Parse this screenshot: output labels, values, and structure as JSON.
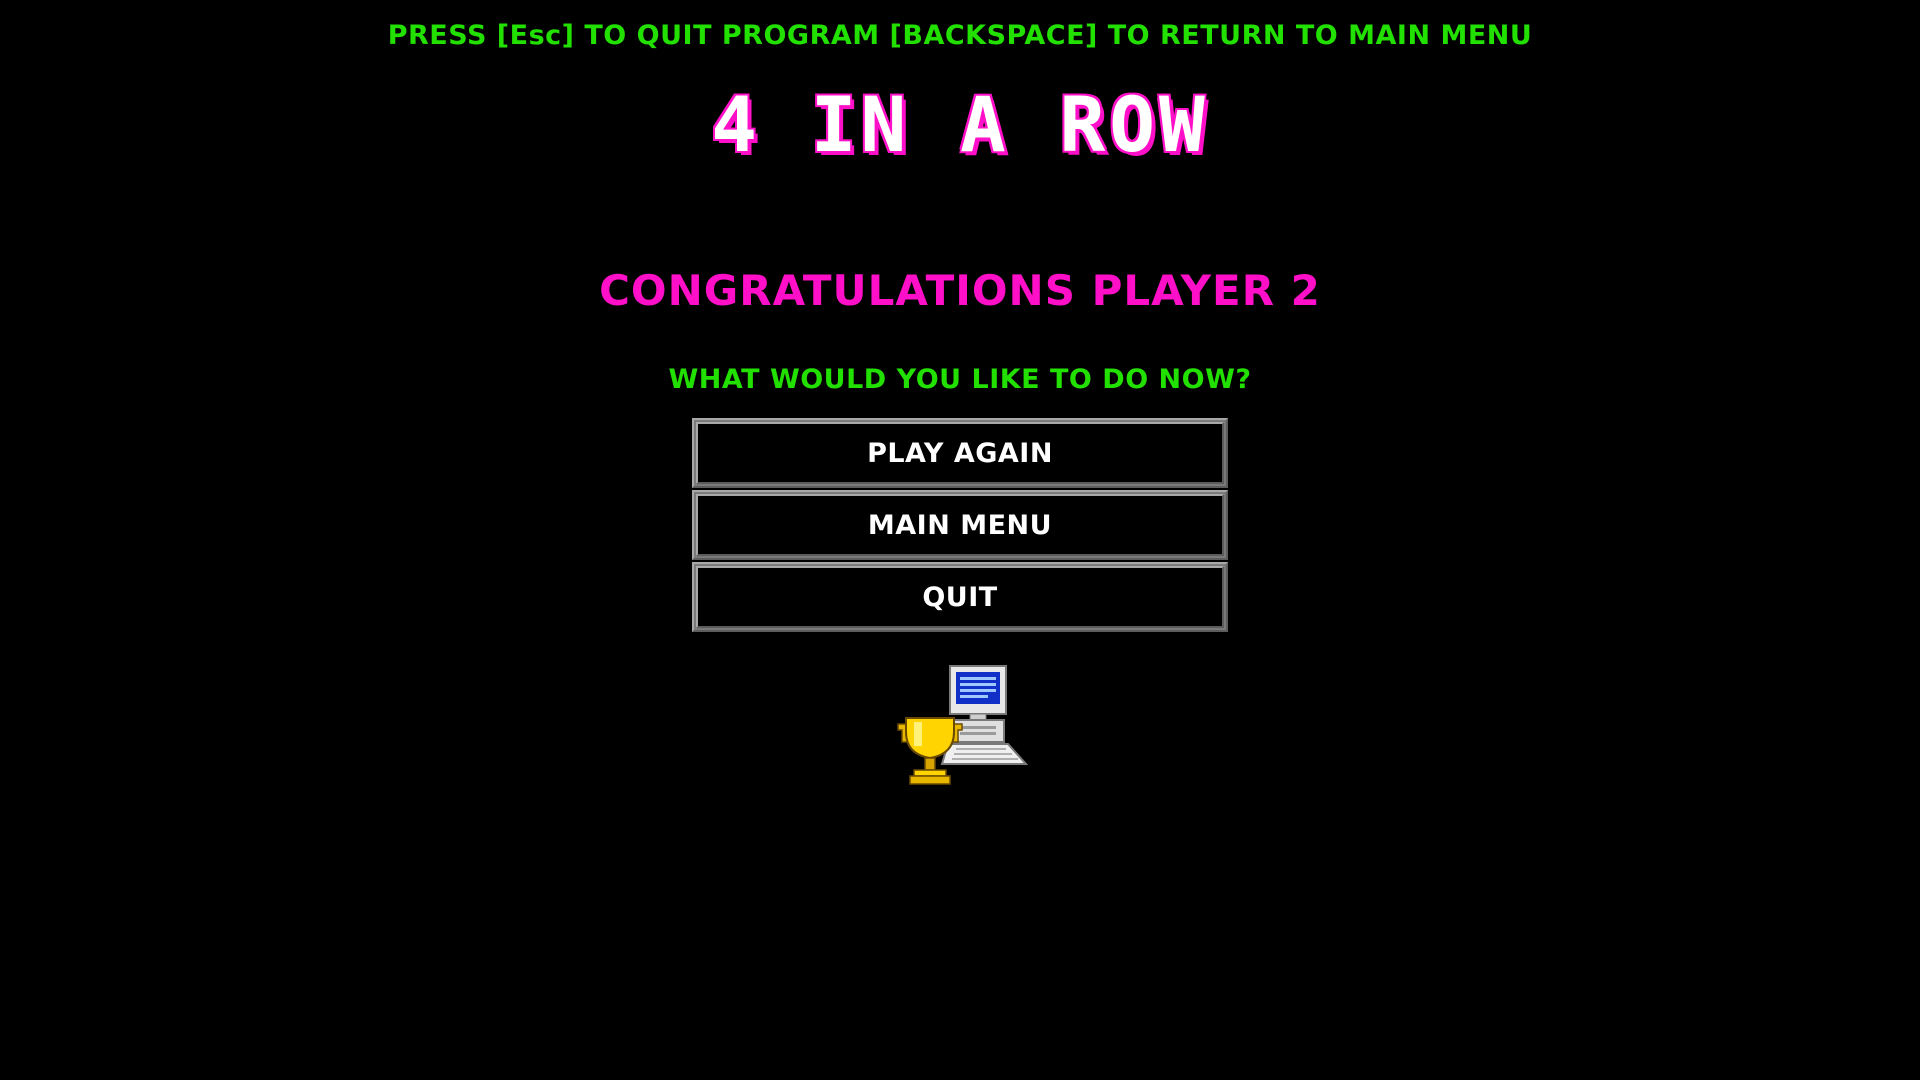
{
  "header": {
    "hint": "PRESS [Esc] TO QUIT PROGRAM [BACKSPACE] TO RETURN TO MAIN MENU",
    "title": "4 IN A ROW"
  },
  "result": {
    "message": "CONGRATULATIONS PLAYER 2",
    "question": "WHAT WOULD YOU LIKE TO DO NOW?"
  },
  "menu": {
    "items": [
      {
        "label": "PLAY AGAIN"
      },
      {
        "label": "MAIN MENU"
      },
      {
        "label": "QUIT"
      }
    ]
  },
  "illustration": {
    "icons": [
      "trophy-icon",
      "computer-icon"
    ]
  },
  "colors": {
    "background": "#000000",
    "hint_text": "#22e000",
    "title_outline": "#ff10c8",
    "congrats_text": "#ff10c8",
    "button_text": "#ffffff",
    "button_border": "#a8a8a8"
  }
}
